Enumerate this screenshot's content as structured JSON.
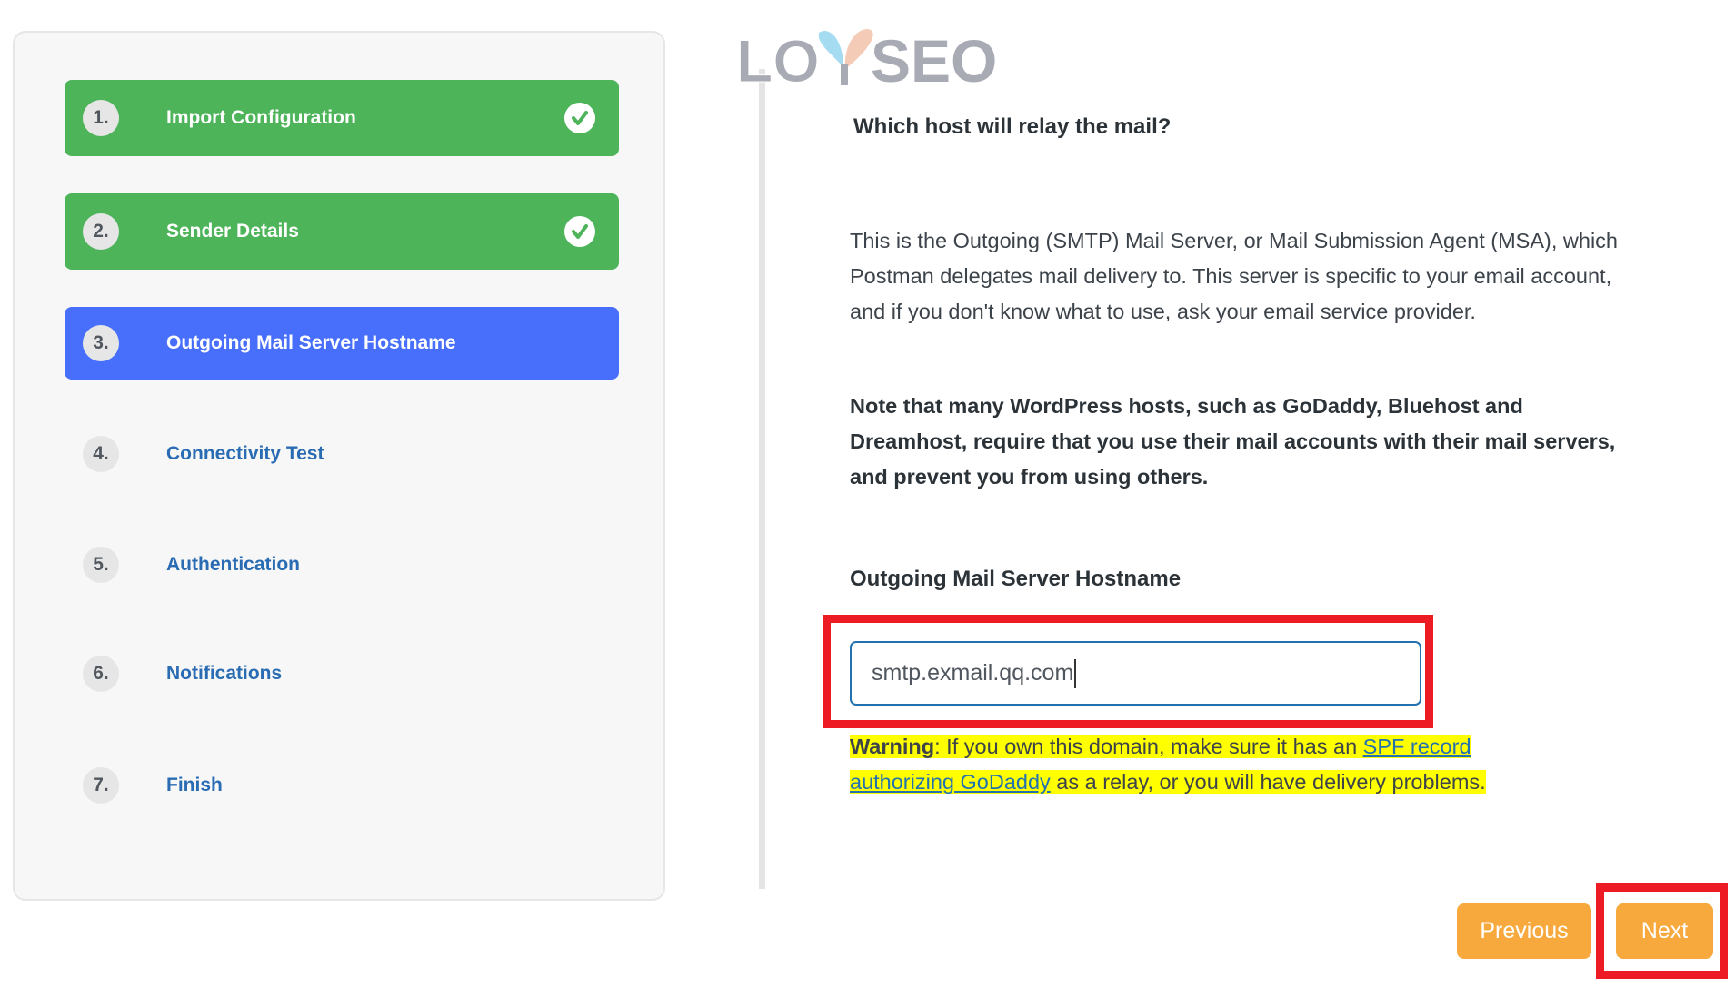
{
  "logo": {
    "text": "LOYSEO"
  },
  "sidebar": {
    "steps": [
      {
        "number": "1.",
        "label": "Import Configuration",
        "state": "done",
        "icon": "check-circle-icon"
      },
      {
        "number": "2.",
        "label": "Sender Details",
        "state": "done",
        "icon": "check-circle-icon"
      },
      {
        "number": "3.",
        "label": "Outgoing Mail Server Hostname",
        "state": "active"
      },
      {
        "number": "4.",
        "label": "Connectivity Test",
        "state": "todo"
      },
      {
        "number": "5.",
        "label": "Authentication",
        "state": "todo"
      },
      {
        "number": "6.",
        "label": "Notifications",
        "state": "todo"
      },
      {
        "number": "7.",
        "label": "Finish",
        "state": "todo"
      }
    ]
  },
  "main": {
    "question": "Which host will relay the mail?",
    "description": "This is the Outgoing (SMTP) Mail Server, or Mail Submission Agent (MSA), which Postman delegates mail delivery to. This server is specific to your email account, and if you don't know what to use, ask your email service provider.",
    "note": "Note that many WordPress hosts, such as GoDaddy, Bluehost and Dreamhost, require that you use their mail accounts with their mail servers, and prevent you from using others.",
    "field_label": "Outgoing Mail Server Hostname",
    "hostname_value": "smtp.exmail.qq.com",
    "warning": {
      "label": "Warning",
      "text_before": ": If you own this domain, make sure it has an ",
      "link1": "SPF record",
      "link2": "authorizing GoDaddy",
      "text_after": " as a relay, or you will have delivery problems."
    }
  },
  "buttons": {
    "previous": "Previous",
    "next": "Next"
  },
  "colors": {
    "done": "#4db45a",
    "active": "#476ffc",
    "button": "#f7a93d",
    "highlight_box": "#ed1c24",
    "warning_bg": "#ffff00"
  }
}
